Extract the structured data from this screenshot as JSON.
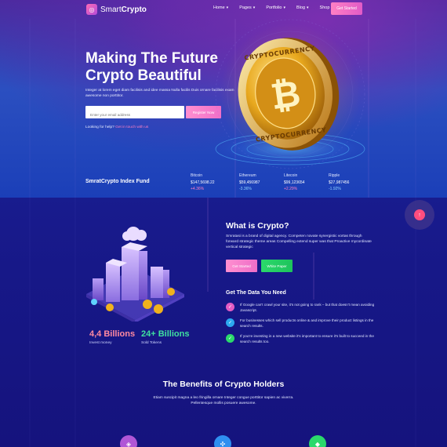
{
  "brand": {
    "logo_light": "Smart",
    "logo_bold": "Crypto"
  },
  "nav": {
    "items": [
      {
        "label": "Home"
      },
      {
        "label": "Pages"
      },
      {
        "label": "Portfolio"
      },
      {
        "label": "Blog"
      },
      {
        "label": "Shop"
      }
    ],
    "cta": "Get Started"
  },
  "hero": {
    "title": "Making The Future Crypto Beautiful",
    "subtitle": "Integer at lorem eget diam facilisis and idee massa Nulla facilis Duis ornare facilisis exam awesome non porttitor.",
    "email_placeholder": "Enter your email address",
    "register_label": "Register Now",
    "help_prefix": "Looking for help?",
    "help_link": "Get in touch with us"
  },
  "index": {
    "title": "SmratCrypto Index Fund",
    "tickers": [
      {
        "name": "Bitcoin",
        "price": "$147,5698.22",
        "change": "+4.36%",
        "direction": "up"
      },
      {
        "name": "Ethereum",
        "price": "$59,456987",
        "change": "-3.36%",
        "direction": "down"
      },
      {
        "name": "Litecoin",
        "price": "$99,123654",
        "change": "+2.29%",
        "direction": "up"
      },
      {
        "name": "Ripple",
        "price": "$27,987456",
        "change": "-1.92%",
        "direction": "down"
      }
    ]
  },
  "about": {
    "title": "What is Crypto?",
    "text": "Smratasi is a brand of digital agency. Competen novate synergistic vortas through forward strategic theme areas Compelling extend super was that Proactive mycordinate vertical strategic",
    "btn_primary": "Get Started",
    "btn_secondary": "White Paper",
    "need_title": "Get The Data You Need",
    "need_items": [
      {
        "icon": "check-icon",
        "color": "#e35cc4",
        "text": "If Google can't crawl your site, it's not going to rank – but that doesn't mean avoiding Javascript."
      },
      {
        "icon": "check-icon",
        "color": "#2ca8f0",
        "text": "For businesses which sell products online & and improve their product listings in the search results."
      },
      {
        "icon": "check-icon",
        "color": "#2bd96b",
        "text": "If you're investing in a new website it's important to ensure it's built to succeed in the search results too."
      }
    ]
  },
  "stats": [
    {
      "value": "4,4 Billions",
      "label": "Invest money",
      "color": "#ff8aa0"
    },
    {
      "value": "24+ Billions",
      "label": "Sold Tokens",
      "color": "#3fe0a0"
    }
  ],
  "benefits": {
    "title": "The Benefits of Crypto Holders",
    "text": "Etiam suscipit magna a leo fringilla ornare Integer congue porttitor sapien ac viverra. Pellentesque mollis posuere awesome."
  },
  "coin": {
    "ring_text": "CRYPTOCURRENCY",
    "symbol": "₿"
  },
  "colors": {
    "accent_pink": "#ff7fc4",
    "accent_green": "#2bd96b",
    "bg_deep": "#15137d"
  }
}
